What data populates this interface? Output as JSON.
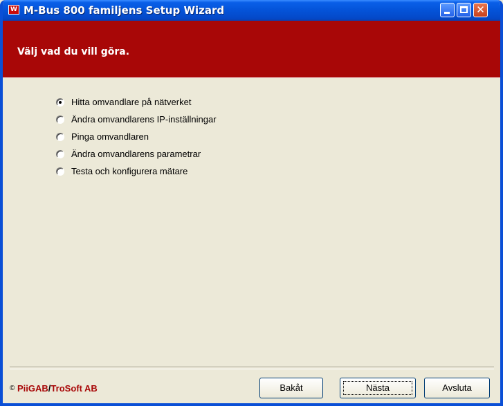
{
  "window": {
    "title": "M-Bus 800 familjens Setup Wizard",
    "app_icon_letter": "W",
    "minimize_icon": "minimize-icon",
    "maximize_icon": "maximize-icon",
    "close_icon": "close-icon",
    "close_glyph": "✕"
  },
  "banner": {
    "heading": "Välj vad du vill göra.",
    "color": "#a80707"
  },
  "options": [
    {
      "label": "Hitta omvandlare på nätverket",
      "checked": true
    },
    {
      "label": "Ändra omvandlarens IP-inställningar",
      "checked": false
    },
    {
      "label": "Pinga omvandlaren",
      "checked": false
    },
    {
      "label": "Ändra omvandlarens parametrar",
      "checked": false
    },
    {
      "label": "Testa och konfigurera mätare",
      "checked": false
    }
  ],
  "footer": {
    "copyright_symbol": "©",
    "brand_part1": "PiiGAB",
    "separator": "/",
    "brand_part2": "TroSoft AB",
    "back_label": "Bakåt",
    "next_label": "Nästa",
    "quit_label": "Avsluta"
  }
}
